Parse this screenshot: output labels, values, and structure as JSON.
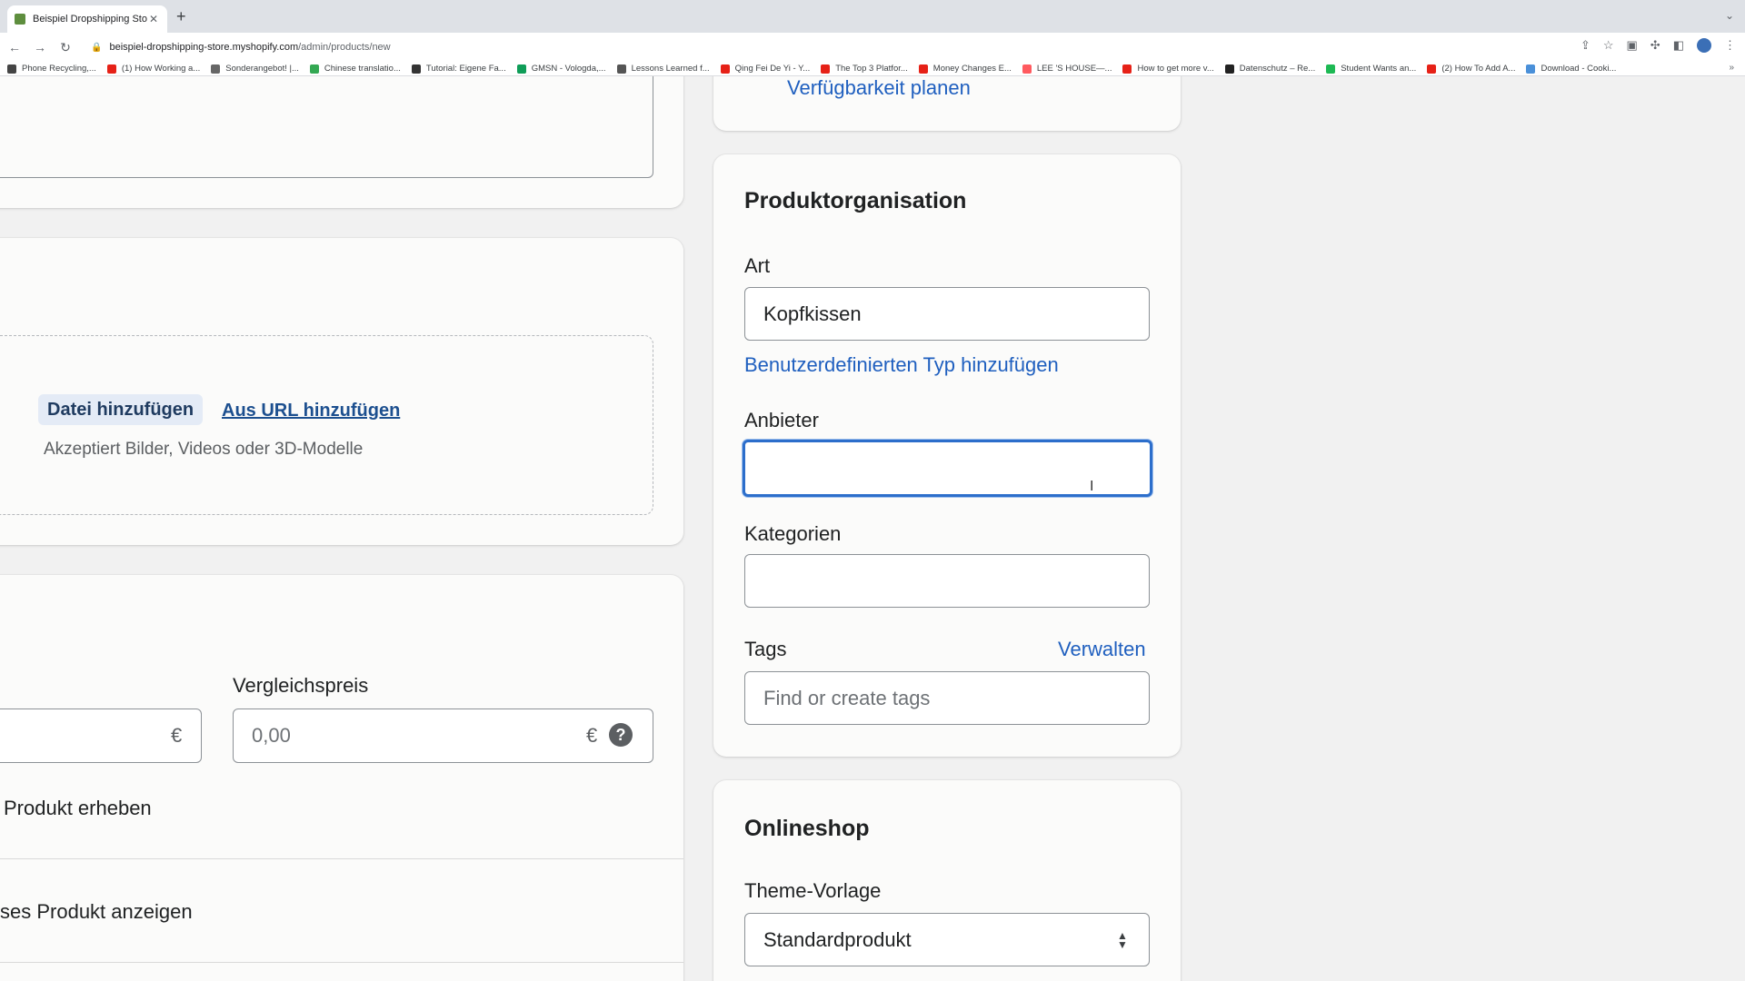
{
  "browser": {
    "tab_title": "Beispiel Dropshipping Store · F",
    "new_tab_symbol": "+",
    "url_host": "beispiel-dropshipping-store.myshopify.com",
    "url_path": "/admin/products/new",
    "bookmarks": [
      {
        "label": "Phone Recycling,...",
        "color": "#444444"
      },
      {
        "label": "(1) How Working a...",
        "color": "#e62117"
      },
      {
        "label": "Sonderangebot! |...",
        "color": "#666666"
      },
      {
        "label": "Chinese translatio...",
        "color": "#34a853"
      },
      {
        "label": "Tutorial: Eigene Fa...",
        "color": "#333333"
      },
      {
        "label": "GMSN - Vologda,...",
        "color": "#0f9d58"
      },
      {
        "label": "Lessons Learned f...",
        "color": "#555555"
      },
      {
        "label": "Qing Fei De Yi - Y...",
        "color": "#e62117"
      },
      {
        "label": "The Top 3 Platfor...",
        "color": "#e62117"
      },
      {
        "label": "Money Changes E...",
        "color": "#e62117"
      },
      {
        "label": "LEE 'S HOUSE—...",
        "color": "#ff5a5f"
      },
      {
        "label": "How to get more v...",
        "color": "#e62117"
      },
      {
        "label": "Datenschutz – Re...",
        "color": "#222222"
      },
      {
        "label": "Student Wants an...",
        "color": "#1db954"
      },
      {
        "label": "(2) How To Add A...",
        "color": "#e62117"
      },
      {
        "label": "Download - Cooki...",
        "color": "#4a90d9"
      }
    ]
  },
  "left": {
    "media": {
      "add_file_button": "Datei hinzufügen",
      "add_from_url_link": "Aus URL hinzufügen",
      "accepted_text": "Akzeptiert Bilder, Videos oder 3D-Modelle"
    },
    "pricing": {
      "currency": "€",
      "compare_label": "Vergleichspreis",
      "compare_placeholder": "0,00",
      "help_symbol": "?",
      "tax_text": "Produkt erheben",
      "show_text": "ses Produkt anzeigen"
    }
  },
  "right": {
    "availability_link": "Verfügbarkeit planen",
    "organization": {
      "title": "Produktorganisation",
      "type_label": "Art",
      "type_value": "Kopfkissen",
      "custom_type_link": "Benutzerdefinierten Typ hinzufügen",
      "vendor_label": "Anbieter",
      "vendor_value": "",
      "categories_label": "Kategorien",
      "categories_value": "",
      "tags_label": "Tags",
      "tags_manage_link": "Verwalten",
      "tags_placeholder": "Find or create tags"
    },
    "online_store": {
      "title": "Onlineshop",
      "theme_label": "Theme-Vorlage",
      "theme_value": "Standardprodukt"
    }
  },
  "colors": {
    "link": "#1f5fbf",
    "focus_border": "#2c6ecb",
    "page_bg": "#f1f1f1"
  }
}
